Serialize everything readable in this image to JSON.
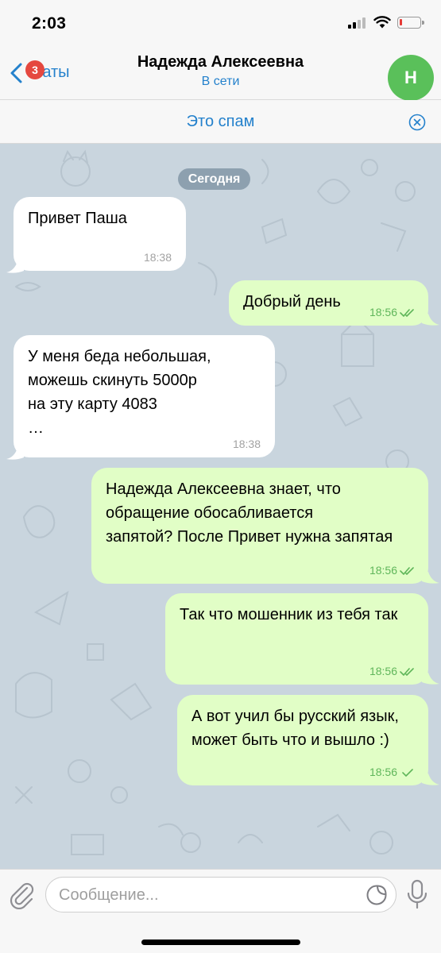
{
  "status_bar": {
    "time": "2:03"
  },
  "nav": {
    "back_label": "Чаты",
    "unread_badge": "3",
    "title": "Надежда Алексеевна",
    "status": "В сети",
    "avatar_letter": "Н"
  },
  "spam_bar": {
    "label": "Это спам"
  },
  "chat": {
    "date_label": "Сегодня",
    "messages": [
      {
        "direction": "in",
        "text": "Привет Паша",
        "time": "18:38"
      },
      {
        "direction": "out",
        "text": "Добрый день",
        "time": "18:56",
        "read": true
      },
      {
        "direction": "in",
        "text": "У меня беда небольшая,\nможешь скинуть 5000р\nна эту карту 4083\n…",
        "time": "18:38"
      },
      {
        "direction": "out",
        "text": "Надежда Алексеевна знает, что\nобращение обосабливается\nзапятой? После Привет нужна запятая",
        "time": "18:56",
        "read": true
      },
      {
        "direction": "out",
        "text": "Так что мошенник из тебя так",
        "time": "18:56",
        "read": true
      },
      {
        "direction": "out",
        "text": "А вот учил бы русский язык,\nможет быть что и вышло :)",
        "time": "18:56",
        "read": false
      }
    ]
  },
  "input": {
    "placeholder": "Сообщение..."
  },
  "colors": {
    "accent": "#2481cc",
    "outgoing_bubble": "#e1fec6",
    "incoming_bubble": "#ffffff",
    "badge": "#e5483f",
    "avatar": "#5ac05a"
  },
  "icons": [
    "back-chevron-icon",
    "signal-icon",
    "wifi-icon",
    "battery-icon",
    "close-circle-icon",
    "double-check-icon",
    "single-check-icon",
    "paperclip-icon",
    "sticker-icon",
    "microphone-icon"
  ]
}
